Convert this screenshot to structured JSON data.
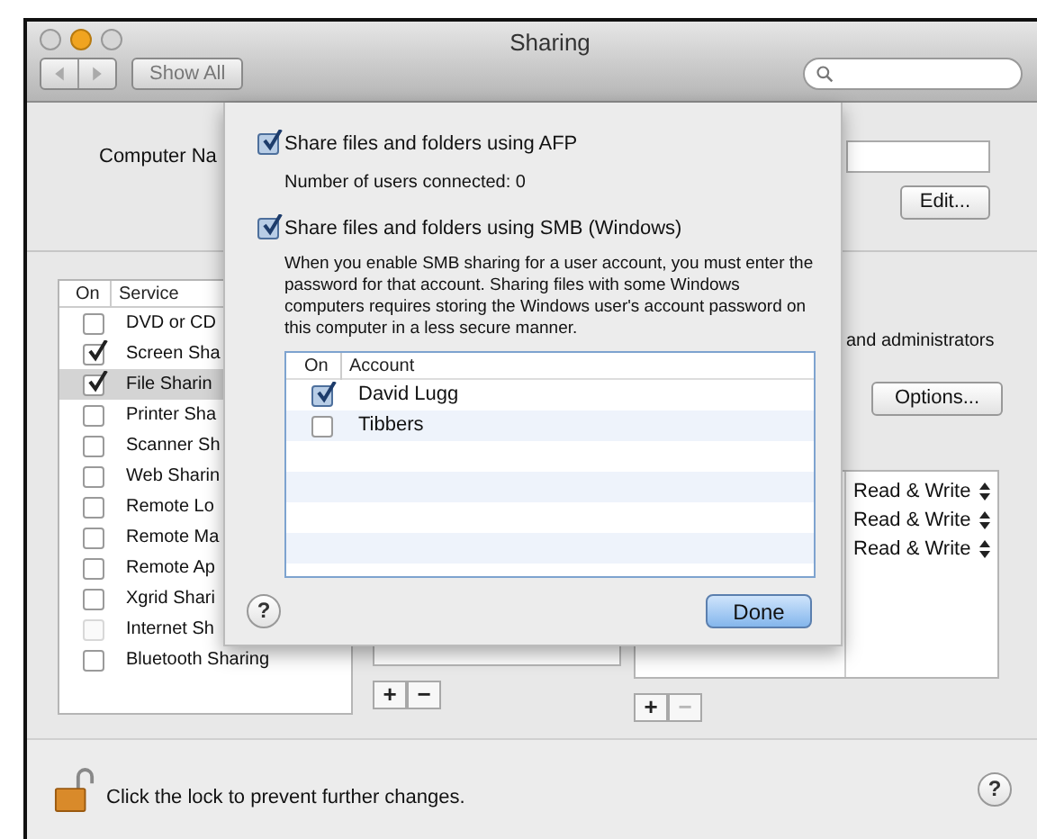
{
  "window": {
    "title": "Sharing"
  },
  "toolbar": {
    "show_all": "Show All"
  },
  "computer_name": {
    "label": "Computer Na",
    "edit_button": "Edit..."
  },
  "services": {
    "columns": [
      "On",
      "Service"
    ],
    "items": [
      {
        "name": "DVD or CD",
        "checked": false,
        "disabled": false,
        "selected": false
      },
      {
        "name": "Screen Sha",
        "checked": true,
        "disabled": false,
        "selected": false
      },
      {
        "name": "File Sharin",
        "checked": true,
        "disabled": false,
        "selected": true
      },
      {
        "name": "Printer Sha",
        "checked": false,
        "disabled": false,
        "selected": false
      },
      {
        "name": "Scanner Sh",
        "checked": false,
        "disabled": false,
        "selected": false
      },
      {
        "name": "Web Sharin",
        "checked": false,
        "disabled": false,
        "selected": false
      },
      {
        "name": "Remote Lo",
        "checked": false,
        "disabled": false,
        "selected": false
      },
      {
        "name": "Remote Ma",
        "checked": false,
        "disabled": false,
        "selected": false
      },
      {
        "name": "Remote Ap",
        "checked": false,
        "disabled": false,
        "selected": false
      },
      {
        "name": "Xgrid Shari",
        "checked": false,
        "disabled": false,
        "selected": false
      },
      {
        "name": "Internet Sh",
        "checked": false,
        "disabled": true,
        "selected": false
      },
      {
        "name": "Bluetooth Sharing",
        "checked": false,
        "disabled": false,
        "selected": false
      }
    ]
  },
  "access_note": "and administrators",
  "options_button": "Options...",
  "permissions": [
    "Read & Write",
    "Read & Write",
    "Read & Write"
  ],
  "folder_buttons": [
    {
      "label": "+",
      "disabled": false
    },
    {
      "label": "−",
      "disabled": false
    }
  ],
  "user_buttons": [
    {
      "label": "+",
      "disabled": false
    },
    {
      "label": "−",
      "disabled": true
    }
  ],
  "lock": {
    "text": "Click the lock to prevent further changes.",
    "help": "?"
  },
  "sheet": {
    "afp": {
      "label": "Share files and folders using AFP",
      "checked": true
    },
    "afp_status": "Number of users connected: 0",
    "smb": {
      "label": "Share files and folders using SMB (Windows)",
      "checked": true
    },
    "smb_note": "When you enable SMB sharing for a user account, you must enter the password for that account. Sharing files with some Windows computers requires storing the Windows user's account password on this computer in a less secure manner.",
    "accounts": {
      "columns": [
        "On",
        "Account"
      ],
      "rows": [
        {
          "name": "David Lugg",
          "checked": true
        },
        {
          "name": "Tibbers",
          "checked": false
        }
      ]
    },
    "help": "?",
    "done_button": "Done"
  }
}
